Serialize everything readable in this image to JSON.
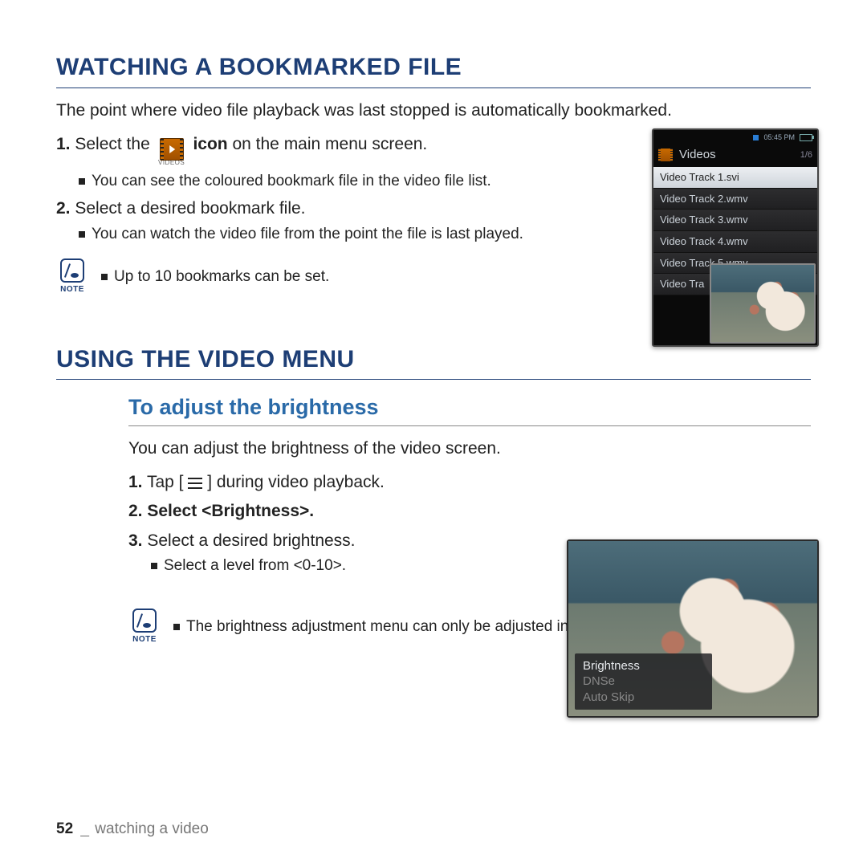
{
  "section1": {
    "title": "WATCHING A BOOKMARKED FILE",
    "intro": "The point where video file playback was last stopped is automatically bookmarked.",
    "step1_pre": "Select the",
    "step1_bold": "icon",
    "step1_post": "on the main menu screen.",
    "step1_num": "1.",
    "videos_icon_label": "VIDEOS",
    "sub1": "You can see the coloured bookmark file in the video file list.",
    "step2_num": "2.",
    "step2_text": "Select a desired bookmark file.",
    "sub2": "You can watch the video file from the point the file is last played.",
    "note_label": "NOTE",
    "note_text": "Up to 10 bookmarks can be set."
  },
  "device1": {
    "time": "05:45 PM",
    "title": "Videos",
    "count": "1/6",
    "items": [
      "Video Track 1.svi",
      "Video Track 2.wmv",
      "Video Track 3.wmv",
      "Video Track 4.wmv",
      "Video Track 5.wmv",
      "Video Tra"
    ]
  },
  "section2": {
    "title": "USING THE VIDEO MENU",
    "subtitle": "To adjust the brightness",
    "intro": "You can adjust the brightness of the video screen.",
    "step1_num": "1.",
    "step1_pre": "Tap [",
    "step1_post": "] during video playback.",
    "step2_num": "2.",
    "step2_text": "Select <Brightness>.",
    "step3_num": "3.",
    "step3_text": "Select a desired brightness.",
    "sub1": "Select a level from <0-10>.",
    "note_label": "NOTE",
    "note_text": "The brightness adjustment menu can only be adjusted in the video screen."
  },
  "device2": {
    "options": [
      "Brightness",
      "DNSe",
      "Auto Skip"
    ]
  },
  "footer": {
    "page": "52",
    "sep": "_",
    "section": "watching a video"
  }
}
